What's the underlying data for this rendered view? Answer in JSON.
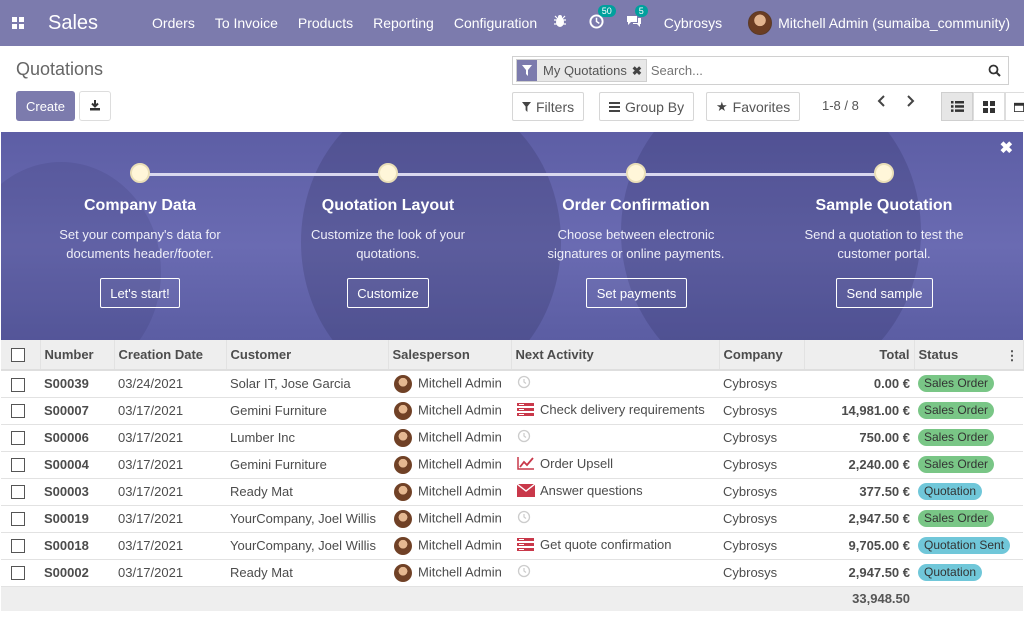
{
  "navbar": {
    "brand": "Sales",
    "menu": [
      "Orders",
      "To Invoice",
      "Products",
      "Reporting",
      "Configuration"
    ],
    "activity_count": "50",
    "message_count": "5",
    "company": "Cybrosys",
    "user": "Mitchell Admin (sumaiba_community)"
  },
  "control_panel": {
    "title": "Quotations",
    "create_label": "Create",
    "facet_label": "My Quotations",
    "search_placeholder": "Search...",
    "filters_label": "Filters",
    "group_by_label": "Group By",
    "favorites_label": "Favorites",
    "pager": "1-8 / 8"
  },
  "banner": {
    "steps": [
      {
        "title": "Company Data",
        "desc": "Set your company's data for documents header/footer.",
        "button": "Let's start!"
      },
      {
        "title": "Quotation Layout",
        "desc": "Customize the look of your quotations.",
        "button": "Customize"
      },
      {
        "title": "Order Confirmation",
        "desc": "Choose between electronic signatures or online payments.",
        "button": "Set payments"
      },
      {
        "title": "Sample Quotation",
        "desc": "Send a quotation to test the customer portal.",
        "button": "Send sample"
      }
    ]
  },
  "table": {
    "headers": {
      "number": "Number",
      "date": "Creation Date",
      "customer": "Customer",
      "salesperson": "Salesperson",
      "activity": "Next Activity",
      "company": "Company",
      "total": "Total",
      "status": "Status"
    },
    "rows": [
      {
        "number": "S00039",
        "date": "03/24/2021",
        "customer": "Solar IT, Jose Garcia",
        "salesperson": "Mitchell Admin",
        "activity": "",
        "activity_icon": "clock-icon",
        "company": "Cybrosys",
        "total": "0.00 €",
        "status": "Sales Order",
        "status_type": "so"
      },
      {
        "number": "S00007",
        "date": "03/17/2021",
        "customer": "Gemini Furniture",
        "salesperson": "Mitchell Admin",
        "activity": "Check delivery requirements",
        "activity_icon": "tasks-icon",
        "company": "Cybrosys",
        "total": "14,981.00 €",
        "status": "Sales Order",
        "status_type": "so"
      },
      {
        "number": "S00006",
        "date": "03/17/2021",
        "customer": "Lumber Inc",
        "salesperson": "Mitchell Admin",
        "activity": "",
        "activity_icon": "clock-icon",
        "company": "Cybrosys",
        "total": "750.00 €",
        "status": "Sales Order",
        "status_type": "so"
      },
      {
        "number": "S00004",
        "date": "03/17/2021",
        "customer": "Gemini Furniture",
        "salesperson": "Mitchell Admin",
        "activity": "Order Upsell",
        "activity_icon": "chart-line-icon",
        "company": "Cybrosys",
        "total": "2,240.00 €",
        "status": "Sales Order",
        "status_type": "so"
      },
      {
        "number": "S00003",
        "date": "03/17/2021",
        "customer": "Ready Mat",
        "salesperson": "Mitchell Admin",
        "activity": "Answer questions",
        "activity_icon": "envelope-icon",
        "company": "Cybrosys",
        "total": "377.50 €",
        "status": "Quotation",
        "status_type": "q"
      },
      {
        "number": "S00019",
        "date": "03/17/2021",
        "customer": "YourCompany, Joel Willis",
        "salesperson": "Mitchell Admin",
        "activity": "",
        "activity_icon": "clock-icon",
        "company": "Cybrosys",
        "total": "2,947.50 €",
        "status": "Sales Order",
        "status_type": "so"
      },
      {
        "number": "S00018",
        "date": "03/17/2021",
        "customer": "YourCompany, Joel Willis",
        "salesperson": "Mitchell Admin",
        "activity": "Get quote confirmation",
        "activity_icon": "tasks-icon",
        "company": "Cybrosys",
        "total": "9,705.00 €",
        "status": "Quotation Sent",
        "status_type": "q"
      },
      {
        "number": "S00002",
        "date": "03/17/2021",
        "customer": "Ready Mat",
        "salesperson": "Mitchell Admin",
        "activity": "",
        "activity_icon": "clock-icon",
        "company": "Cybrosys",
        "total": "2,947.50 €",
        "status": "Quotation",
        "status_type": "q"
      }
    ],
    "grand_total": "33,948.50"
  },
  "colors": {
    "brand": "#7c7bad",
    "sales_order_badge": "#79c686",
    "quotation_badge": "#70c7d9"
  }
}
